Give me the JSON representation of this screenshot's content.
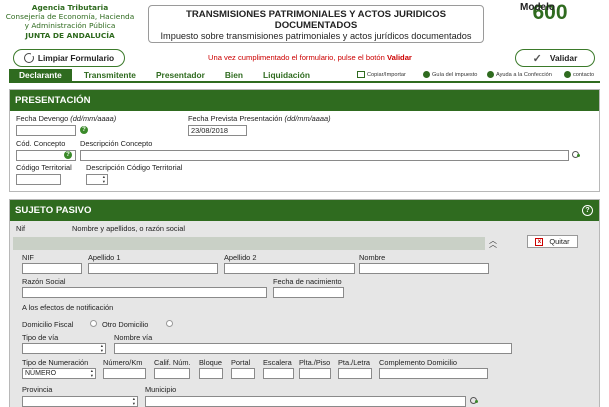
{
  "header": {
    "agency_lines": [
      "Agencia Tributaria",
      "Consejería de Economía, Hacienda",
      "y Administración Pública",
      "JUNTA DE ANDALUCÍA"
    ],
    "title": "TRANSMISIONES PATRIMONIALES Y ACTOS JURIDICOS DOCUMENTADOS",
    "subtitle": "Impuesto sobre transmisiones patrimoniales y actos jurídicos documentados",
    "modelo_label": "Modelo",
    "modelo_number": "600"
  },
  "actions": {
    "clean_label": "Limpiar Formulario",
    "validate_label": "Validar",
    "instruction_text": "Una vez cumplimentado el formulario, pulse el botón ",
    "instruction_bold": "Validar"
  },
  "tabs": [
    "Declarante",
    "Transmitente",
    "Presentador",
    "Bien",
    "Liquidación"
  ],
  "tools": {
    "copy": "Copiar/Importar",
    "guide": "Guía del impuesto",
    "help": "Ayuda a la Confección",
    "contact": "contacto"
  },
  "presentacion": {
    "title": "PRESENTACIÓN",
    "fecha_devengo_label": "Fecha Devengo ",
    "fecha_format": "(dd/mm/aaaa)",
    "fecha_prevista_label": "Fecha Prevista Presentación ",
    "fecha_prevista_value": "23/08/2018",
    "cod_concepto_label": "Cód. Concepto",
    "desc_concepto_label": "Descripción Concepto",
    "cod_territorial_label": "Código Territorial",
    "desc_territorial_label": "Descripción Código Territorial"
  },
  "sujeto_pasivo": {
    "title": "SUJETO PASIVO",
    "nif_header": "Nif",
    "nombre_header": "Nombre y apellidos, o razón social",
    "quitar_label": "Quitar",
    "nif": "NIF",
    "apellido1": "Apellido 1",
    "apellido2": "Apellido 2",
    "nombre": "Nombre",
    "razon_social": "Razón Social",
    "fecha_nacimiento": "Fecha de nacimiento",
    "notificacion": "A los efectos de notificación",
    "domicilio_fiscal": "Domicilio Fiscal",
    "otro_domicilio": "Otro Domicilio",
    "tipo_via": "Tipo de vía",
    "nombre_via": "Nombre vía",
    "tipo_numeracion": "Tipo de Numeración",
    "tipo_numeracion_value": "NÚMERO",
    "numero_km": "Número/Km",
    "calif_num": "Calif. Núm.",
    "bloque": "Bloque",
    "portal": "Portal",
    "escalera": "Escalera",
    "planta_piso": "Plta./Piso",
    "puerta_letra": "Pta./Letra",
    "complemento": "Complemento Domicilio",
    "provincia": "Provincia",
    "municipio": "Municipio"
  },
  "icons": {
    "help": "help-icon",
    "search": "search-icon",
    "close": "close-icon",
    "collapse": "collapse-icon"
  },
  "colors": {
    "brand_green": "#2f6b1f",
    "alert_red": "#cc0000",
    "panel_grey": "#e6e6e6"
  }
}
